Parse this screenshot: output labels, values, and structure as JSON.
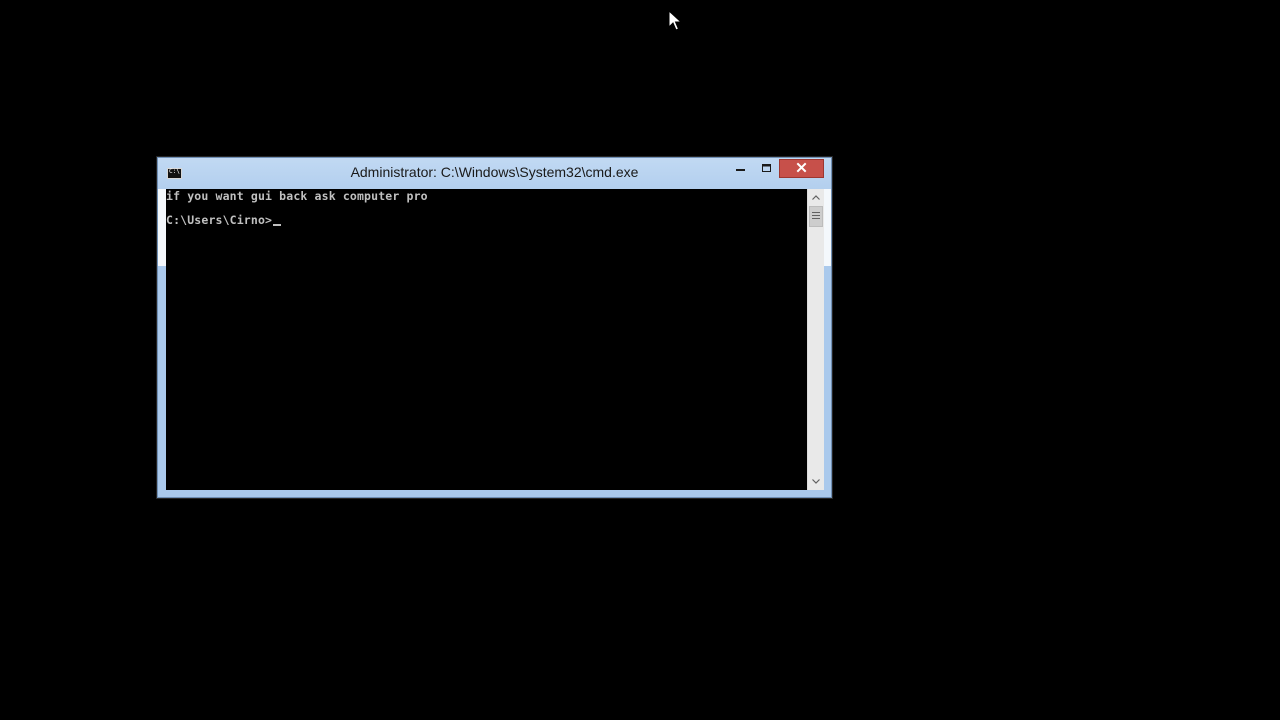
{
  "window": {
    "title": "Administrator: C:\\Windows\\System32\\cmd.exe",
    "icon": "console-app-icon",
    "controls": {
      "minimize_icon": "minimize-icon",
      "maximize_icon": "maximize-icon",
      "close_icon": "close-icon",
      "close_color": "#c7504a"
    }
  },
  "console": {
    "lines": [
      "if you want gui back ask computer pro",
      "C:\\Users\\Cirno>"
    ],
    "text_color": "#c0c0c0",
    "background": "#000000"
  },
  "scrollbar": {
    "up_icon": "scroll-up-arrow-icon",
    "down_icon": "scroll-down-arrow-icon"
  },
  "desktop": {
    "background": "#000000",
    "cursor_icon": "mouse-pointer-icon"
  }
}
